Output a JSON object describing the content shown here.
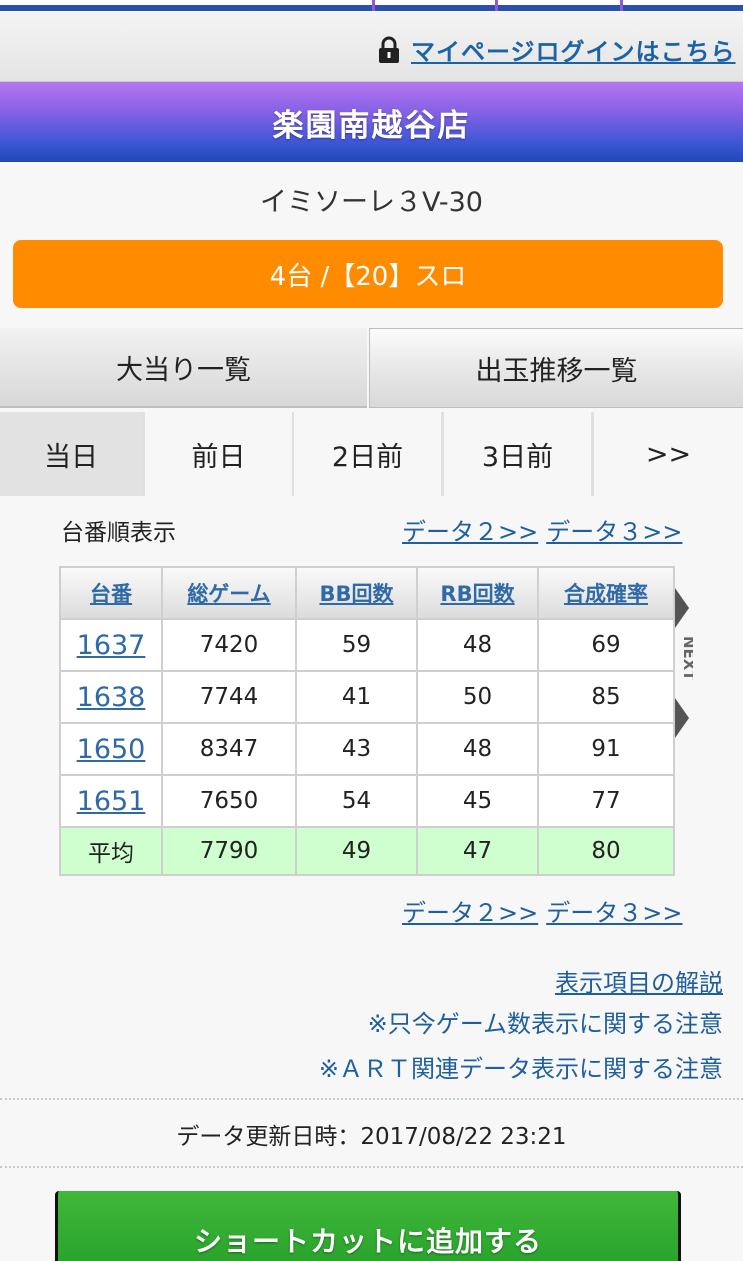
{
  "header": {
    "login_link": "マイページログインはこちら",
    "store_name": "楽園南越谷店"
  },
  "machine": {
    "name": "イミソーレ３V-30",
    "rate": "4台 /【20】スロ"
  },
  "tabs": [
    {
      "label": "大当り一覧"
    },
    {
      "label": "出玉推移一覧"
    }
  ],
  "days": [
    {
      "label": "当日",
      "active": true
    },
    {
      "label": "前日"
    },
    {
      "label": "2日前"
    },
    {
      "label": "3日前"
    },
    {
      "label": ">>"
    }
  ],
  "sort_label": "台番順表示",
  "data_links": {
    "data2": "データ２>>",
    "data3": "データ３>>"
  },
  "table": {
    "headers": [
      "台番",
      "総ゲーム",
      "BB回数",
      "RB回数",
      "合成確率"
    ],
    "rows": [
      [
        "1637",
        "7420",
        "59",
        "48",
        "69"
      ],
      [
        "1638",
        "7744",
        "41",
        "50",
        "85"
      ],
      [
        "1650",
        "8347",
        "43",
        "48",
        "91"
      ],
      [
        "1651",
        "7650",
        "54",
        "45",
        "77"
      ]
    ],
    "average": [
      "平均",
      "7790",
      "49",
      "47",
      "80"
    ],
    "next_label": "NEXT"
  },
  "notes": {
    "explain": "表示項目の解説",
    "game_count_note": "※只今ゲーム数表示に関する注意",
    "art_note": "※ＡＲＴ関連データ表示に関する注意"
  },
  "updated": "データ更新日時：2017/08/22 23:21",
  "shortcut_button": "ショートカットに追加する",
  "colors": {
    "accent_orange": "#ff8c00",
    "link_blue": "#1f5f9e",
    "avg_row_green": "#cfffcf",
    "button_green": "#2fa92f"
  }
}
